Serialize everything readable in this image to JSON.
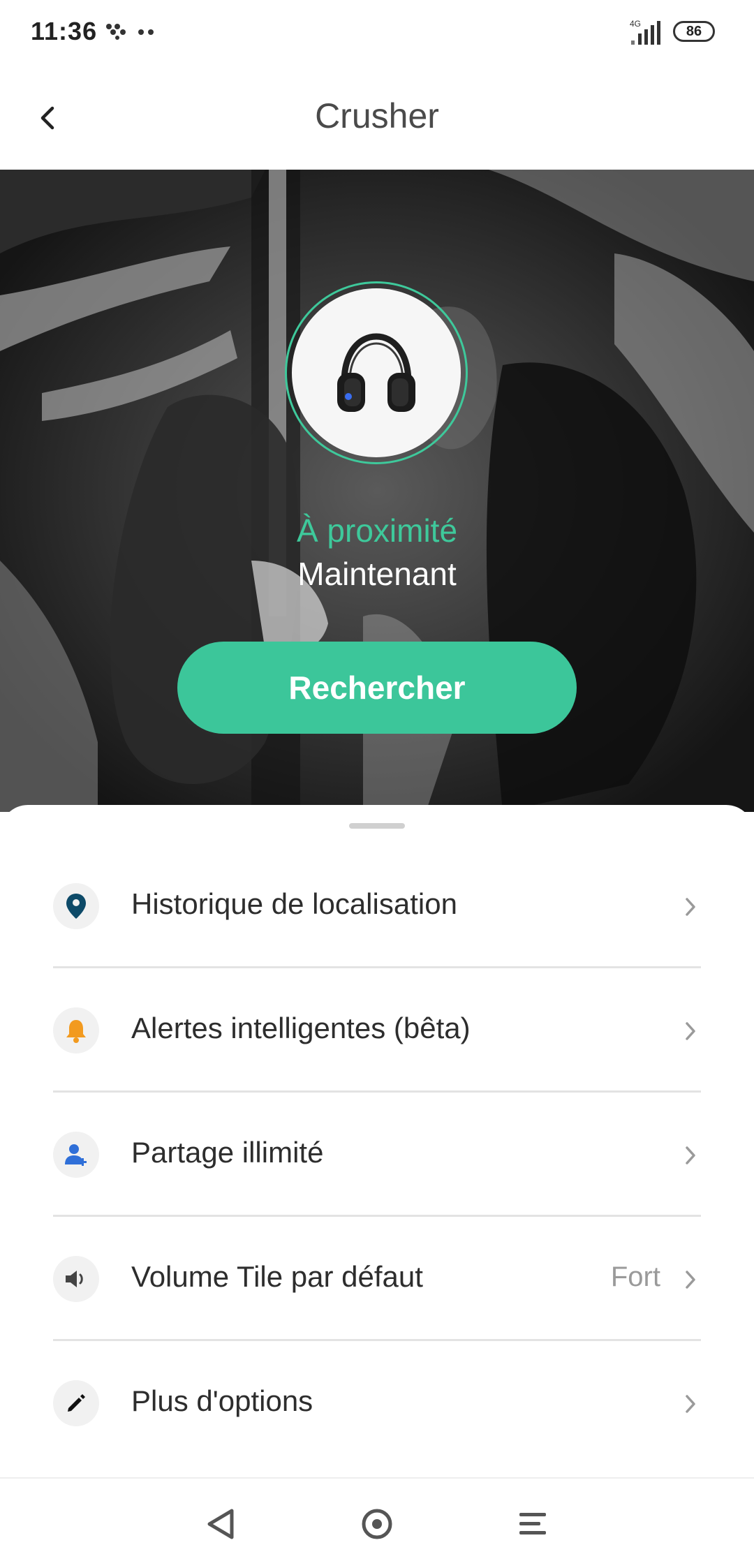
{
  "status_bar": {
    "time": "11:36",
    "network": "4G",
    "battery": "86"
  },
  "header": {
    "title": "Crusher"
  },
  "hero": {
    "proximity_status": "À proximité",
    "last_seen": "Maintenant",
    "search_button": "Rechercher"
  },
  "menu": {
    "items": [
      {
        "label": "Historique de localisation",
        "value": "",
        "icon": "location-pin-icon",
        "icon_color": "#0d4a68"
      },
      {
        "label": "Alertes intelligentes (bêta)",
        "value": "",
        "icon": "bell-icon",
        "icon_color": "#f29a1f"
      },
      {
        "label": "Partage illimité",
        "value": "",
        "icon": "add-person-icon",
        "icon_color": "#2f6fd8"
      },
      {
        "label": "Volume Tile par défaut",
        "value": "Fort",
        "icon": "speaker-icon",
        "icon_color": "#444444"
      },
      {
        "label": "Plus d'options",
        "value": "",
        "icon": "pencil-icon",
        "icon_color": "#111111"
      }
    ]
  },
  "colors": {
    "accent": "#3cc69a",
    "text_primary": "#2d2d2d",
    "text_secondary": "#9a9a9a"
  }
}
